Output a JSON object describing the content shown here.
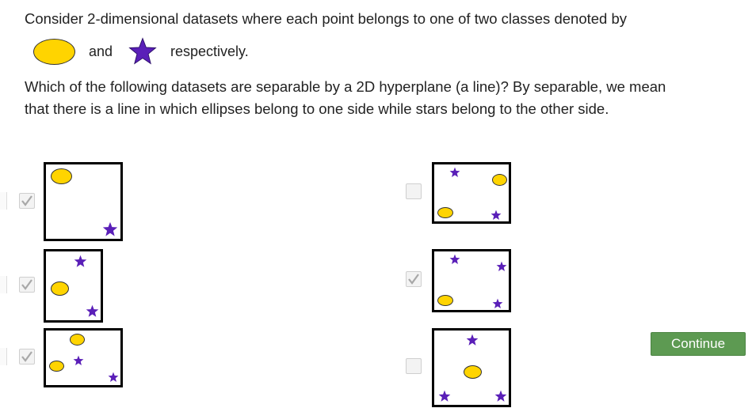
{
  "question": {
    "line1": "Consider 2-dimensional datasets where each point belongs to one of two classes denoted by",
    "legend_and": "and",
    "legend_respectively": "respectively.",
    "line2": "Which of the following datasets are separable by a 2D hyperplane (a line)? By separable, we mean",
    "line3": "that there is a line in which ellipses belong to one side while stars belong to the other side."
  },
  "colors": {
    "ellipse_fill": "#ffd400",
    "star_fill": "#5a1fb8",
    "checkmark": "#a8a8a8",
    "continue_bg": "#5d9a52"
  },
  "options": [
    {
      "id": "opt-1",
      "checked": true
    },
    {
      "id": "opt-2",
      "checked": false
    },
    {
      "id": "opt-3",
      "checked": true
    },
    {
      "id": "opt-4",
      "checked": true
    },
    {
      "id": "opt-5",
      "checked": true
    },
    {
      "id": "opt-6",
      "checked": false
    }
  ],
  "continue_label": "Continue"
}
